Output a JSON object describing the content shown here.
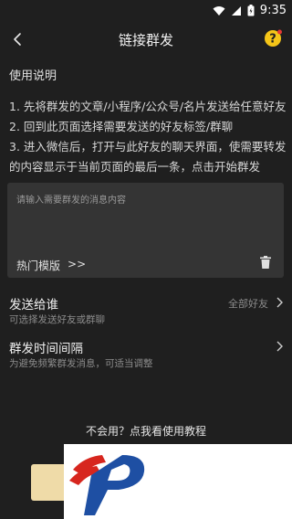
{
  "status_bar": {
    "time": "9:35"
  },
  "header": {
    "title": "链接群发"
  },
  "usage": {
    "heading": "使用说明",
    "lines": [
      "1. 先将群发的文章/小程序/公众号/名片发送给任意好友",
      "2. 回到此页面选择需要发送的好友标签/群聊",
      "3. 进入微信后，打开与此好友的聊天界面，使需要转发的内容显示于当前页面的最后一条，点击开始群发"
    ]
  },
  "message_box": {
    "placeholder": "请输入需要群发的消息内容",
    "templates_label": "热门模版",
    "templates_arrow": ">>"
  },
  "send_to": {
    "title": "发送给谁",
    "subtitle": "可选择发送好友或群聊",
    "value": "全部好友"
  },
  "interval": {
    "title": "群发时间间隔",
    "subtitle": "为避免频繁群发消息，可适当调整"
  },
  "footer": {
    "tutorial_text": "不会用？点我看使用教程"
  },
  "colors": {
    "background": "#1f1f1f",
    "panel": "#343434",
    "accent_yellow": "#f5c518",
    "button_gold": "#efdba8",
    "logo_red": "#d7261e",
    "logo_blue": "#1e4fa3"
  }
}
